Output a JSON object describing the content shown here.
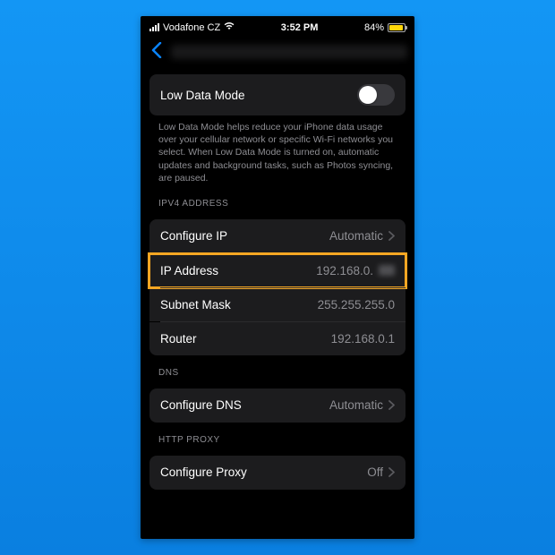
{
  "status": {
    "carrier": "Vodafone CZ",
    "time": "3:52 PM",
    "battery_pct": "84%"
  },
  "low_data": {
    "title": "Low Data Mode",
    "description": "Low Data Mode helps reduce your iPhone data usage over your cellular network or specific Wi-Fi networks you select. When Low Data Mode is turned on, automatic updates and background tasks, such as Photos syncing, are paused."
  },
  "ipv4": {
    "header": "IPV4 ADDRESS",
    "configure_ip_label": "Configure IP",
    "configure_ip_value": "Automatic",
    "ip_label": "IP Address",
    "ip_value": "192.168.0.",
    "subnet_label": "Subnet Mask",
    "subnet_value": "255.255.255.0",
    "router_label": "Router",
    "router_value": "192.168.0.1"
  },
  "dns": {
    "header": "DNS",
    "configure_label": "Configure DNS",
    "configure_value": "Automatic"
  },
  "proxy": {
    "header": "HTTP PROXY",
    "configure_label": "Configure Proxy",
    "configure_value": "Off"
  }
}
